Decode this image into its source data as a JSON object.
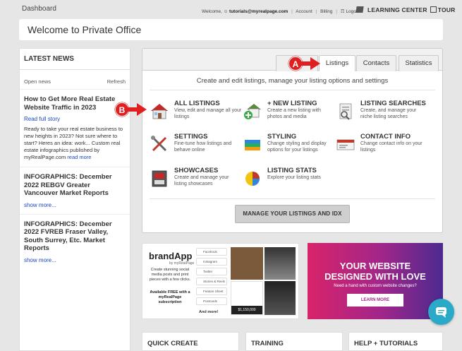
{
  "topbar": {
    "dashboard": "Dashboard",
    "welcome_prefix": "Welcome,",
    "user_email": "tutorials@myrealpage.com",
    "account": "Account",
    "billing": "Billing",
    "logout": "Logout",
    "learning_center": "LEARNING CENTER",
    "tour": "TOUR"
  },
  "header": {
    "title": "Welcome to Private Office"
  },
  "news": {
    "title": "LATEST NEWS",
    "open_news": "Open news",
    "refresh": "Refresh",
    "items": [
      {
        "title": "How to Get More Real Estate Website Traffic in 2023",
        "link": "Read full story",
        "body": "Ready to take your real estate business to new heights in 2023? Not sure where to start? Heres an idea: work... Custom real estate infographics published by myRealPage.com",
        "more": "read more"
      },
      {
        "title": "INFOGRAPHICS: December 2022 REBGV Greater Vancouver Market Reports",
        "link": "show more..."
      },
      {
        "title": "INFOGRAPHICS: December 2022 FVREB Fraser Valley, South Surrey, Etc. Market Reports",
        "link": "show more..."
      }
    ]
  },
  "panel": {
    "tabs": [
      "W",
      "Listings",
      "Contacts",
      "Statistics"
    ],
    "active_tab": "Listings",
    "heading": "Create and edit listings, manage your listing options and settings",
    "options": [
      {
        "title": "ALL LISTINGS",
        "desc": "View, edit and manage all your listings",
        "icon": "house-icon"
      },
      {
        "title": "+ NEW LISTING",
        "desc": "Create a new listing with photos and media",
        "icon": "new-house-icon"
      },
      {
        "title": "LISTING SEARCHES",
        "desc": "Create, and manage your niche listing searches",
        "icon": "search-document-icon"
      },
      {
        "title": "SETTINGS",
        "desc": "Fine-tune how listings and behave online",
        "icon": "tools-icon"
      },
      {
        "title": "STYLING",
        "desc": "Change styling and display options for your listings",
        "icon": "palette-books-icon"
      },
      {
        "title": "CONTACT INFO",
        "desc": "Change contact info on your listings",
        "icon": "contact-card-icon"
      },
      {
        "title": "SHOWCASES",
        "desc": "Create and manage your listing showcases",
        "icon": "showcase-icon"
      },
      {
        "title": "LISTING STATS",
        "desc": "Explore your listing stats",
        "icon": "pie-chart-icon"
      }
    ],
    "manage_button": "MANAGE YOUR LISTINGS AND IDX"
  },
  "annotations": {
    "a": "A",
    "b": "B",
    "color": "#e02020"
  },
  "promo_brandapp": {
    "logo": "brandApp",
    "by": "by myRealPage",
    "text": "Create stunning social media posts and print pieces with a few clicks.",
    "avail": "Available FREE with a myRealPage subscription",
    "menu": [
      "Facebook",
      "Instagram",
      "Twitter",
      "Stories & Reels",
      "Feature Sheet",
      "Postcards"
    ],
    "more": "And more!",
    "price": "$1,150,000"
  },
  "promo_website": {
    "line1": "YOUR WEBSITE",
    "line2": "DESIGNED WITH LOVE",
    "sub": "Need a hand with custom website changes?",
    "button": "LEARN MORE"
  },
  "bottom": {
    "quick_create": "QUICK CREATE",
    "training": "TRAINING",
    "help": "HELP + TUTORIALS"
  },
  "colors": {
    "link": "#1a47c4",
    "accent": "#2aa9c9"
  }
}
